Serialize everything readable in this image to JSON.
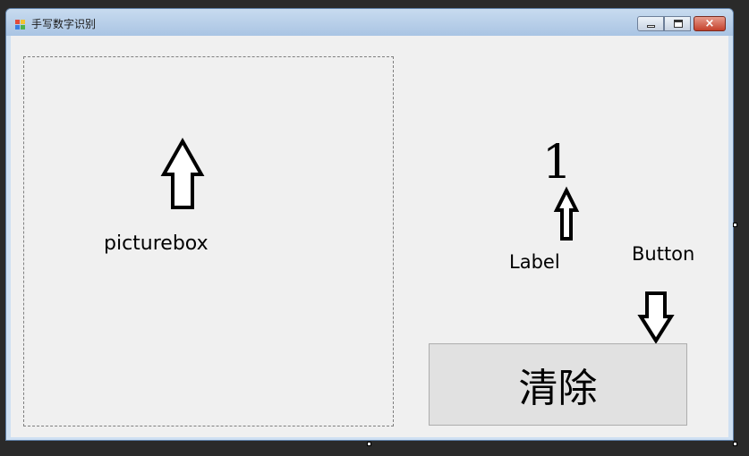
{
  "window": {
    "title": "手写数字识别",
    "controls": {
      "minimize": "minimize",
      "maximize": "maximize",
      "close": "×"
    }
  },
  "annotations": {
    "picturebox": "picturebox",
    "label": "Label",
    "button": "Button"
  },
  "result_label": {
    "text": "1"
  },
  "clear_button": {
    "label": "清除"
  },
  "icons": [
    "app-icon",
    "minimize-icon",
    "maximize-icon",
    "close-icon",
    "arrow-up-icon",
    "arrow-down-icon"
  ]
}
